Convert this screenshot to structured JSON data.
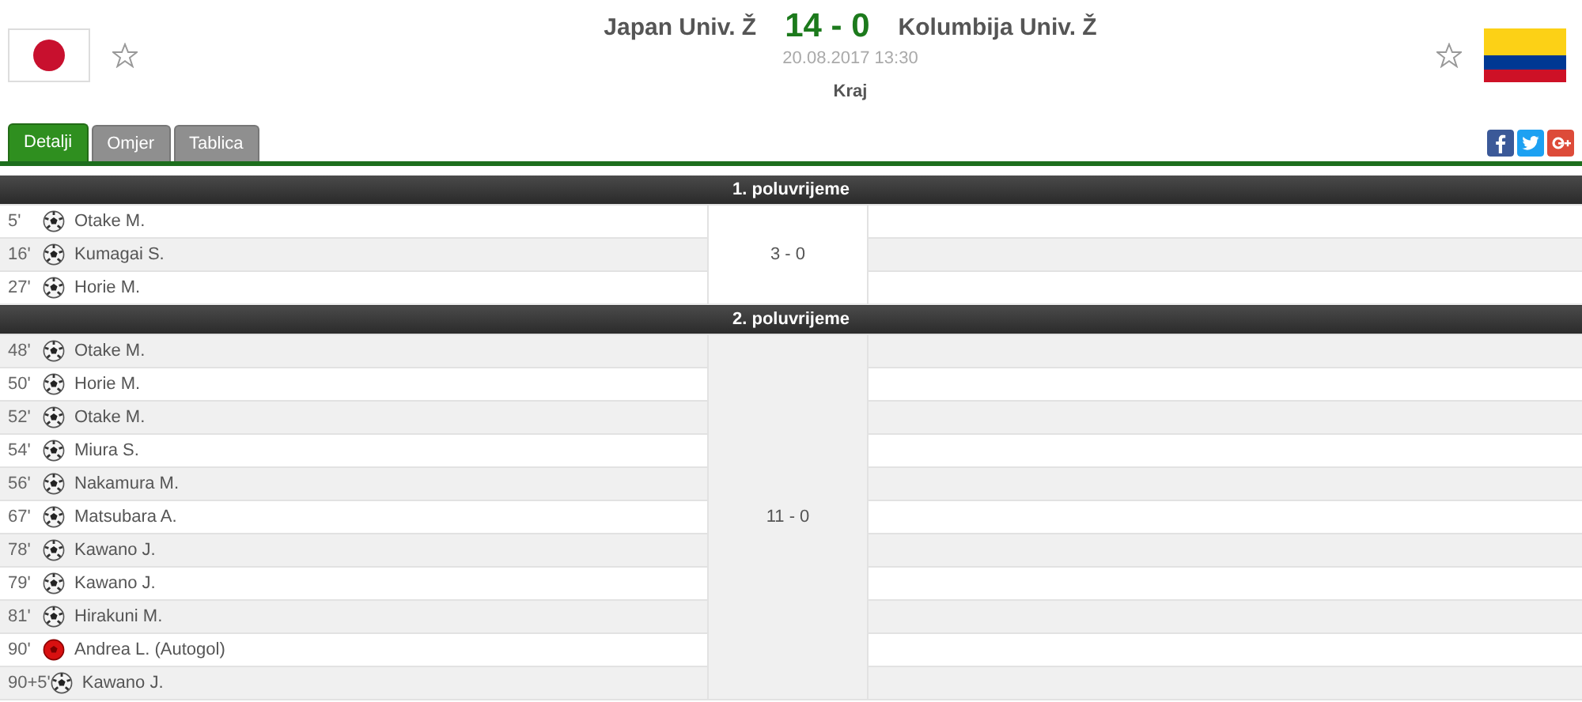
{
  "match": {
    "home": {
      "name": "Japan Univ. Ž",
      "flag": {
        "kind": "japan"
      }
    },
    "away": {
      "name": "Kolumbija Univ. Ž",
      "flag": {
        "kind": "colombia"
      }
    },
    "score": "14 - 0",
    "datetime": "20.08.2017 13:30",
    "status": "Kraj"
  },
  "tabs": [
    {
      "label": "Detalji",
      "selected": true
    },
    {
      "label": "Omjer",
      "selected": false
    },
    {
      "label": "Tablica",
      "selected": false
    }
  ],
  "periods": [
    {
      "title": "1. poluvrijeme",
      "score": "3 - 0",
      "events": [
        {
          "minute": "5'",
          "kind": "goal",
          "player": "Otake M."
        },
        {
          "minute": "16'",
          "kind": "goal",
          "player": "Kumagai S."
        },
        {
          "minute": "27'",
          "kind": "goal",
          "player": "Horie M."
        }
      ]
    },
    {
      "title": "2. poluvrijeme",
      "score": "11 - 0",
      "events": [
        {
          "minute": "48'",
          "kind": "goal",
          "player": "Otake M."
        },
        {
          "minute": "50'",
          "kind": "goal",
          "player": "Horie M."
        },
        {
          "minute": "52'",
          "kind": "goal",
          "player": "Otake M."
        },
        {
          "minute": "54'",
          "kind": "goal",
          "player": "Miura S."
        },
        {
          "minute": "56'",
          "kind": "goal",
          "player": "Nakamura M."
        },
        {
          "minute": "67'",
          "kind": "goal",
          "player": "Matsubara A."
        },
        {
          "minute": "78'",
          "kind": "goal",
          "player": "Kawano J."
        },
        {
          "minute": "79'",
          "kind": "goal",
          "player": "Kawano J."
        },
        {
          "minute": "81'",
          "kind": "goal",
          "player": "Hirakuni M."
        },
        {
          "minute": "90'",
          "kind": "own_goal",
          "player": "Andrea L. (Autogol)"
        },
        {
          "minute": "90+5'",
          "kind": "goal",
          "player": "Kawano J."
        }
      ]
    }
  ]
}
